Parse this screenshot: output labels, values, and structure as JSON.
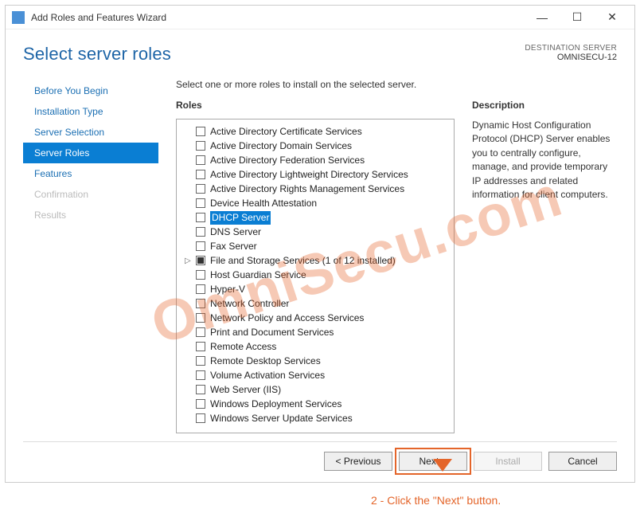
{
  "window": {
    "title": "Add Roles and Features Wizard"
  },
  "header": {
    "page_title": "Select server roles",
    "dest_label": "DESTINATION SERVER",
    "dest_name": "OMNISECU-12"
  },
  "nav": {
    "items": [
      {
        "label": "Before You Begin",
        "state": "normal"
      },
      {
        "label": "Installation Type",
        "state": "normal"
      },
      {
        "label": "Server Selection",
        "state": "normal"
      },
      {
        "label": "Server Roles",
        "state": "selected"
      },
      {
        "label": "Features",
        "state": "normal"
      },
      {
        "label": "Confirmation",
        "state": "disabled"
      },
      {
        "label": "Results",
        "state": "disabled"
      }
    ]
  },
  "main": {
    "instruction": "Select one or more roles to install on the selected server.",
    "roles_header": "Roles",
    "desc_header": "Description",
    "description": "Dynamic Host Configuration Protocol (DHCP) Server enables you to centrally configure, manage, and provide temporary IP addresses and related information for client computers.",
    "roles": [
      {
        "label": "Active Directory Certificate Services",
        "checked": false,
        "selected": false
      },
      {
        "label": "Active Directory Domain Services",
        "checked": false,
        "selected": false
      },
      {
        "label": "Active Directory Federation Services",
        "checked": false,
        "selected": false
      },
      {
        "label": "Active Directory Lightweight Directory Services",
        "checked": false,
        "selected": false
      },
      {
        "label": "Active Directory Rights Management Services",
        "checked": false,
        "selected": false
      },
      {
        "label": "Device Health Attestation",
        "checked": false,
        "selected": false
      },
      {
        "label": "DHCP Server",
        "checked": false,
        "selected": true
      },
      {
        "label": "DNS Server",
        "checked": false,
        "selected": false
      },
      {
        "label": "Fax Server",
        "checked": false,
        "selected": false
      },
      {
        "label": "File and Storage Services (1 of 12 installed)",
        "checked": "partial",
        "selected": false,
        "expandable": true
      },
      {
        "label": "Host Guardian Service",
        "checked": false,
        "selected": false
      },
      {
        "label": "Hyper-V",
        "checked": false,
        "selected": false
      },
      {
        "label": "Network Controller",
        "checked": false,
        "selected": false
      },
      {
        "label": "Network Policy and Access Services",
        "checked": false,
        "selected": false
      },
      {
        "label": "Print and Document Services",
        "checked": false,
        "selected": false
      },
      {
        "label": "Remote Access",
        "checked": false,
        "selected": false
      },
      {
        "label": "Remote Desktop Services",
        "checked": false,
        "selected": false
      },
      {
        "label": "Volume Activation Services",
        "checked": false,
        "selected": false
      },
      {
        "label": "Web Server (IIS)",
        "checked": false,
        "selected": false
      },
      {
        "label": "Windows Deployment Services",
        "checked": false,
        "selected": false
      },
      {
        "label": "Windows Server Update Services",
        "checked": false,
        "selected": false
      }
    ]
  },
  "footer": {
    "previous": "< Previous",
    "next": "Next >",
    "install": "Install",
    "cancel": "Cancel"
  },
  "annotation": {
    "text": "2 -  Click the \"Next\" button.",
    "watermark": "OmniSecu.com"
  }
}
